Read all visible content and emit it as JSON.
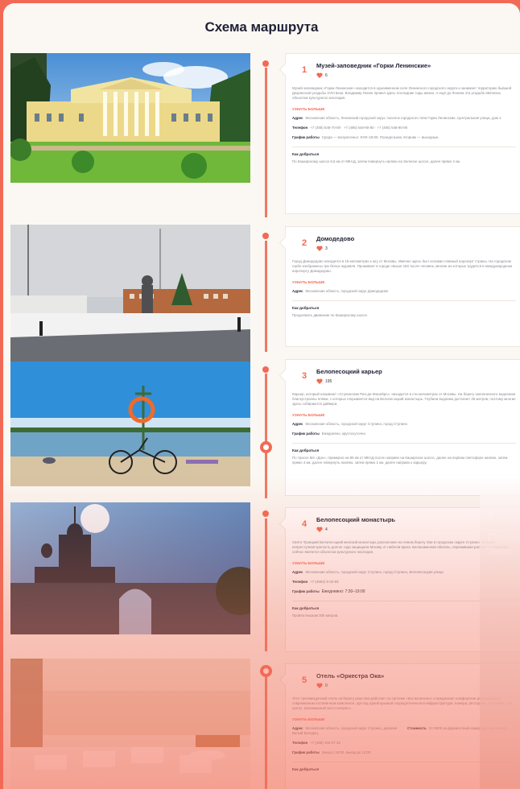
{
  "page_title": "Схема маршрута",
  "more_label": "УЗНАТЬ БОЛЬШЕ",
  "how_label": "Как добраться",
  "ghost": {
    "num": "1",
    "word1": "Посмо",
    "word2": "Эксп"
  },
  "stops": [
    {
      "num": "1",
      "title": "Музей-заповедник «Горки Ленинские»",
      "likes": "6",
      "desc": "Музей-заповедник «Горки Ленинские» находится в одноименном селе Ленинского городского округа и занимает территорию бывшей дворянской усадьбы XVIII века. Владимир Ленин провел здесь последние годы жизни. А ещё до Ленина эта усадьба являлась объектом культурного наследия.",
      "address_label": "Адрес",
      "address": "Московская область, Ленинский городской округ, поселок городского типа Горки Ленинские, Центральная улица, дом 1",
      "phone_label": "Телефон",
      "phone": "+7 (495) 548-70-09 · +7 (495) 548-90-80 · +7 (495) 548-90-90",
      "hours_label": "График работы",
      "hours": "Среда — воскресенье: 9:00–18:00. Понедельник, вторник — выходные.",
      "how": "По Каширскому шоссе 6,5 км от МКАД, затем повернуть налево на Зеленое шоссе, далее прямо 4 км."
    },
    {
      "num": "2",
      "title": "Домодедово",
      "likes": "3",
      "desc": "Город Домодедово находится в 15 километрах к югу от Москвы. Именно здесь был основан главный аэропорт страны. На городском гербе изображены три белых журавля. Проживает в городе свыше 150 тысяч человек, многие из которых трудятся в международном аэропорту Домодедово.",
      "address_label": "Адрес",
      "address": "Московская область, городской округ Домодедово",
      "how": "Продолжить движение по Каширскому шоссе."
    },
    {
      "num": "3",
      "title": "Белопесоцкий карьер",
      "likes": "195",
      "desc": "Карьер, который называют «Ступинским Рио-де-Жанейро», находится в сти километрах от Москвы. На берегу заполненного водоемом благоустроены пляжи, с которых открывается вид на Белопесоцкий монастырь. Глубина водоема достигает 25 метров, поэтому многие здесь собираются дайвера.",
      "address_label": "Адрес",
      "address": "Московская область, городской округ Ступино, город Ступино",
      "hours_label": "График работы",
      "hours": "Ежедневно, круглосуточно",
      "how": "По трассе М4 «Дон», примерно на 85 км от МКАД после направо на Каширское шоссе, далее на первом светофоре налево, затем прямо 4 км, далее повернуть налево, затем прямо 1 км, далее направо к карьеру."
    },
    {
      "num": "4",
      "title": "Белопесоцкий монастырь",
      "likes": "4",
      "desc": "Свято-Троицкий Белопесоцкий женский монастырь расположен на левом берегу Оки в городском округе Ступино. Бывшая непреступная крепость долгое года защищала Москву от набегов врага. Белокаменная обитель, пережившая расцвет и разорение, сейчас является объектом культурного наследия.",
      "address_label": "Адрес",
      "address": "Московская область, городской округ Ступино, город Ступино, Белопесоцкая улица",
      "phone_label": "Телефон",
      "phone": "+7 (4964) 9-33-83",
      "hours_label": "График работы",
      "hours": "Ежедневно: 7:30–19:00",
      "how": "Пройти пешком 300 метров."
    },
    {
      "num": "5",
      "title": "Отель «Оркестра Ока»",
      "likes": "0",
      "desc": "Этот трехзвездочный отель на берегу реки Ока работает по системе «все включено» и предлагает комфортное размещение в современном гостиничном комплексе, где под одной крышей сосредоточена вся инфраструктура: номера, рестораны, бассейны, спа-центр, тренажерный зал и конгресс.",
      "address_label": "Адрес",
      "address": "Московская область, городской округ Ступино, деревня Белый Колодец",
      "price_label": "Стоимость",
      "price": "От 5000 за двухместный номер (все включено)",
      "phone_label": "Телефон",
      "phone": "+7 (495) 150-37-32",
      "hours_label": "График работы",
      "hours": "Заезд с 15:00, выезд до 12:00"
    }
  ]
}
